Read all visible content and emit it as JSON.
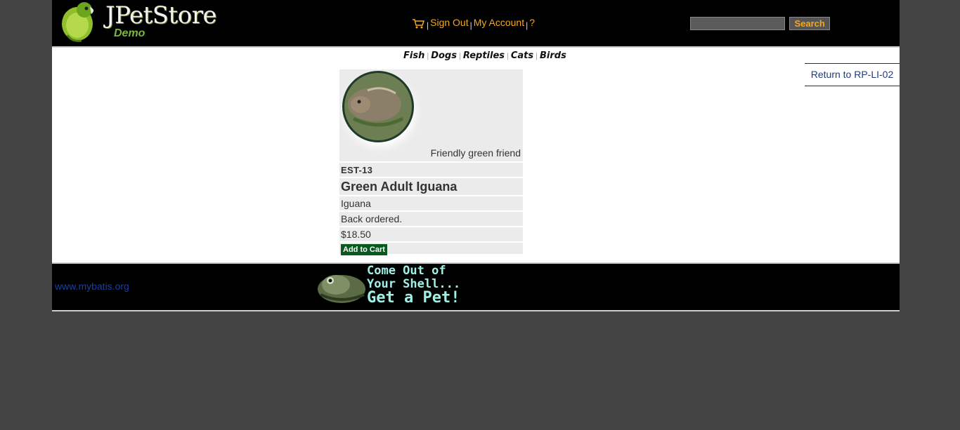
{
  "header": {
    "logo_title": "JPetStore",
    "logo_sub": "Demo",
    "menu": {
      "sign_out": "Sign Out",
      "my_account": "My Account",
      "help": "?"
    },
    "search": {
      "value": "",
      "button": "Search"
    }
  },
  "quicklinks": [
    "Fish",
    "Dogs",
    "Reptiles",
    "Cats",
    "Birds"
  ],
  "return_link": "Return to RP-LI-02",
  "item": {
    "image_caption": "Friendly green friend",
    "id": "EST-13",
    "product_name": "Green Adult Iguana",
    "category": "Iguana",
    "stock": "Back ordered.",
    "price": "$18.50",
    "add_to_cart": "Add to Cart"
  },
  "footer": {
    "link": "www.mybatis.org",
    "banner_line1": "Come Out of",
    "banner_line2": "Your Shell...",
    "banner_line3": "Get a Pet!"
  },
  "colors": {
    "page_bg": "#444444",
    "header_bg": "#000000",
    "menu_link": "#f3a81c",
    "add_to_cart_bg": "#0a5a20"
  }
}
